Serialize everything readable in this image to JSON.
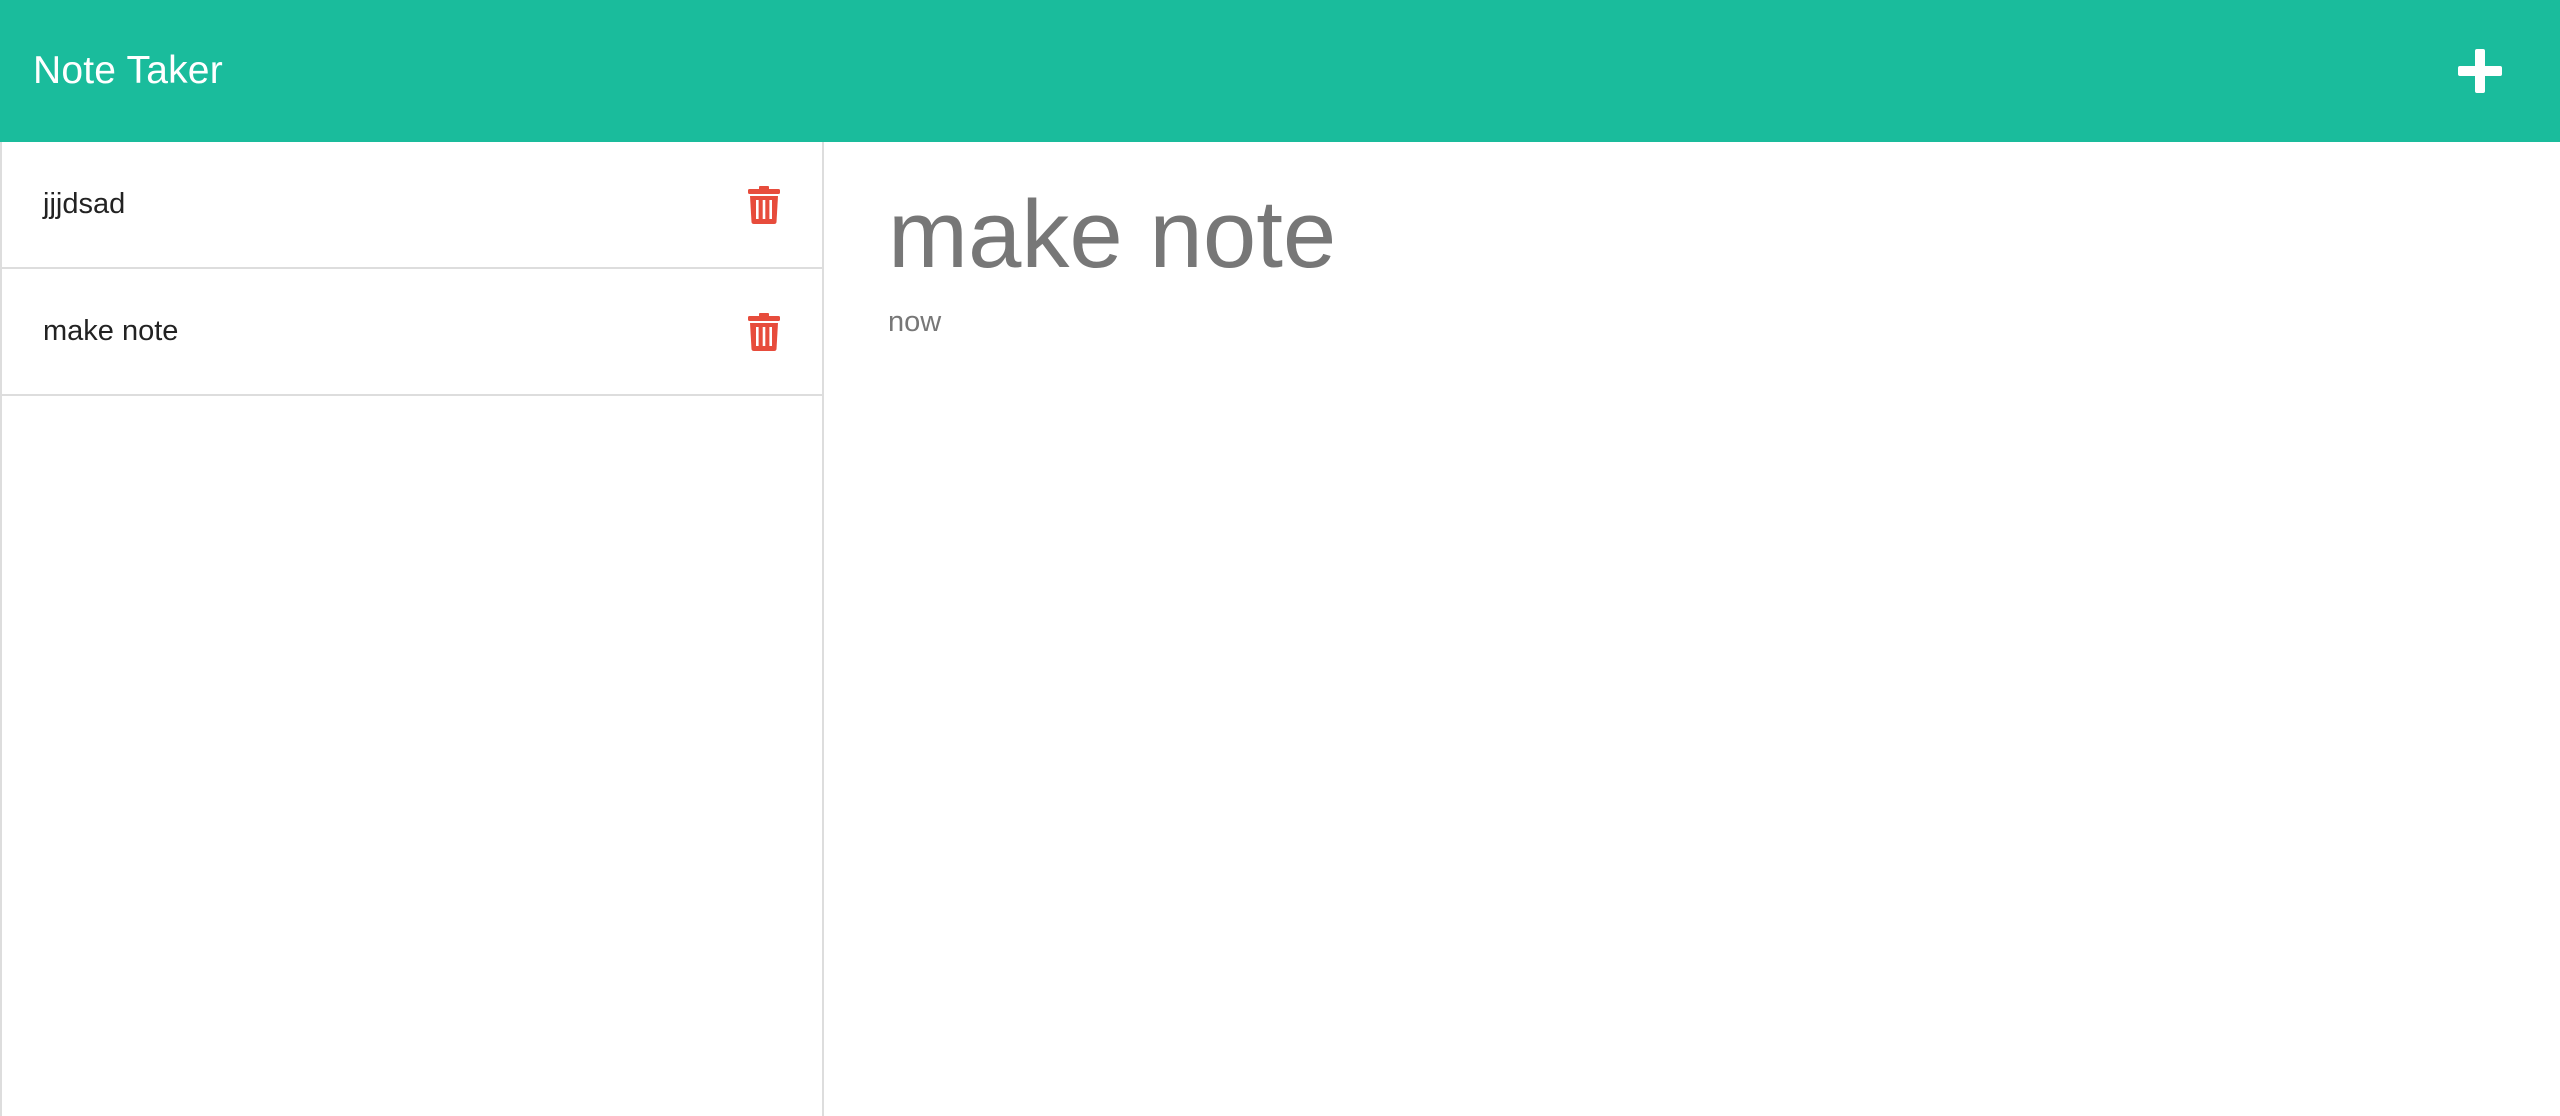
{
  "app": {
    "title": "Note Taker"
  },
  "header": {
    "new_note_icon": "plus-icon"
  },
  "sidebar": {
    "notes": [
      {
        "label": "jjjdsad",
        "delete_icon": "trash-icon"
      },
      {
        "label": "make note",
        "delete_icon": "trash-icon"
      }
    ]
  },
  "editor": {
    "title": "make note",
    "body": "now"
  },
  "colors": {
    "accent": "#1abc9c",
    "delete": "#e74c3c",
    "muted_text": "#777777"
  }
}
